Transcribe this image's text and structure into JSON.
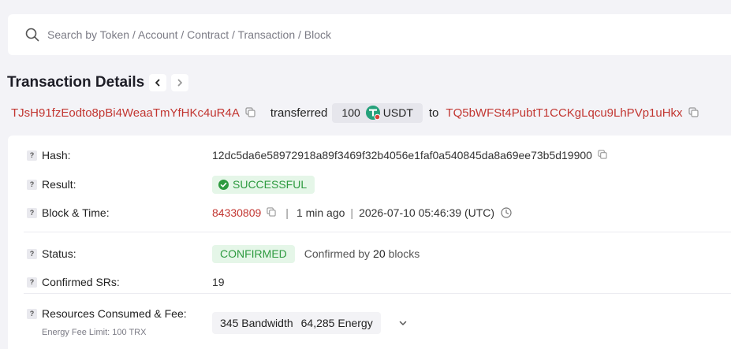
{
  "search": {
    "placeholder": "Search by Token / Account / Contract / Transaction / Block"
  },
  "header": {
    "title": "Transaction Details"
  },
  "summary": {
    "from_address": "TJsH91fzEodto8pBi4WeaaTmYfHKc4uR4A",
    "action": "transferred",
    "amount": "100",
    "token": "USDT",
    "to_word": "to",
    "to_address": "TQ5bWFSt4PubtT1CCKgLqcu9LhPVp1uHkx"
  },
  "details": {
    "hash": {
      "label": "Hash:",
      "value": "12dc5da6e58972918a89f3469f32b4056e1faf0a540845da8a69ee73b5d19900"
    },
    "result": {
      "label": "Result:",
      "value": "SUCCESSFUL"
    },
    "block_time": {
      "label": "Block & Time:",
      "block": "84330809",
      "ago": "1 min ago",
      "timestamp": "2026-07-10 05:46:39 (UTC)"
    },
    "status": {
      "label": "Status:",
      "value": "CONFIRMED",
      "prefix": "Confirmed by",
      "count": "20",
      "suffix": "blocks"
    },
    "confirmed_srs": {
      "label": "Confirmed SRs:",
      "value": "19"
    },
    "resources": {
      "label": "Resources Consumed & Fee:",
      "sublabel": "Energy Fee Limit: 100 TRX",
      "bandwidth": "345 Bandwidth",
      "energy": "64,285 Energy"
    }
  },
  "colors": {
    "link": "#c23631",
    "success": "#2d9a3f",
    "success_bg": "#e5f6e8",
    "tether": "#26a17b"
  },
  "icons": {
    "search": "search-icon",
    "prev": "chevron-left-icon",
    "next": "chevron-right-icon",
    "copy": "copy-icon",
    "help": "help-icon",
    "check": "check-circle-icon",
    "clock": "clock-icon",
    "token": "usdt-token-icon",
    "expand": "chevron-down-icon"
  }
}
